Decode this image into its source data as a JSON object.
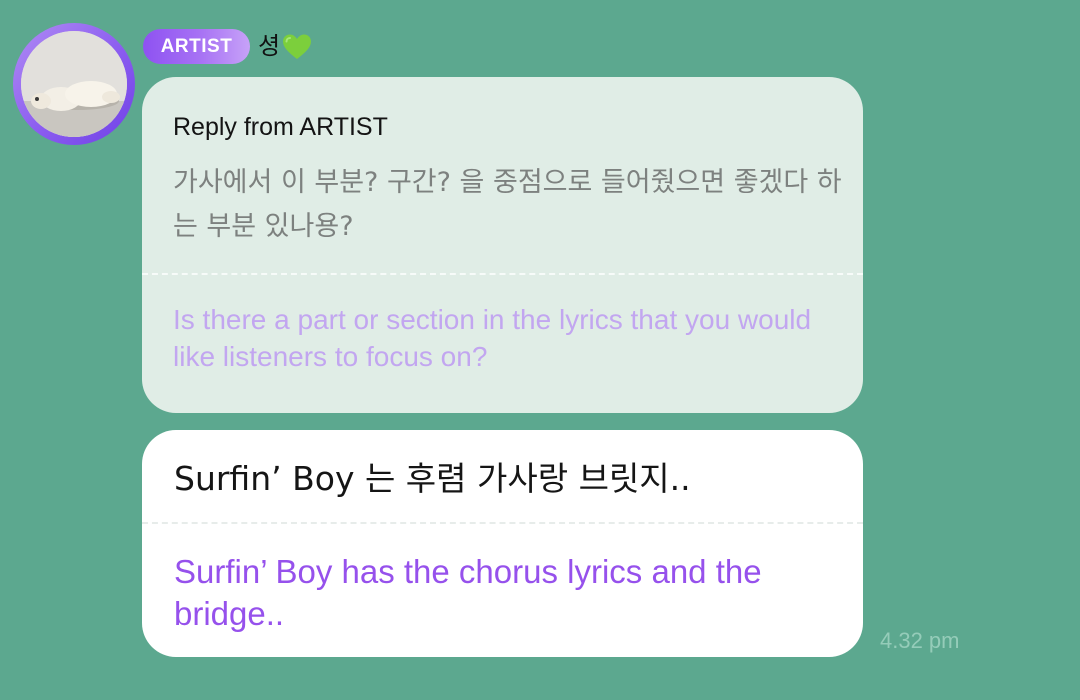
{
  "sender": {
    "badge": "ARTIST",
    "name": "셩",
    "name_icon": "green-heart-icon",
    "avatar": "dog-photo-avatar"
  },
  "reply": {
    "header": "Reply from ARTIST",
    "original_text": "가사에서 이 부분? 구간? 을 중점으로 들어줬으면 좋겠다 하는 부분 있나용?",
    "translation": "Is there a part or section in the lyrics that you would like listeners to focus on?"
  },
  "message": {
    "text": "Surfin’ Boy 는 후렴 가사랑 브릿지..",
    "translation": "Surfin’ Boy has the chorus lyrics and the bridge..",
    "timestamp": "4.32 pm"
  },
  "colors": {
    "background": "#5ca88f",
    "badge_purple": "#8e52f2",
    "translation_purple": "#9651ec",
    "reply_bubble": "#e0ede6"
  }
}
